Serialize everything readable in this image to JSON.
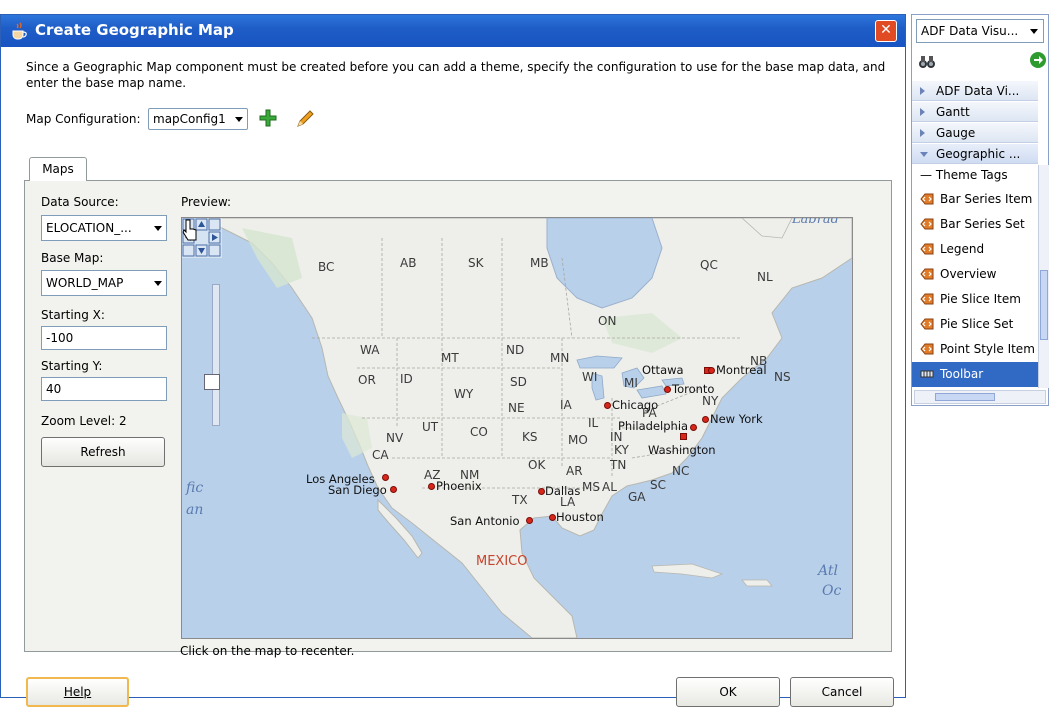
{
  "dialog": {
    "title": "Create Geographic Map",
    "close_label": "✕",
    "description": "Since a Geographic Map component must be created before you can add a theme, specify the configuration to use for the base map data, and enter the base map name.",
    "map_config_label": "Map Configuration:",
    "map_config_value": "mapConfig1",
    "tab_label": "Maps",
    "data_source_label": "Data Source:",
    "data_source_value": "ELOCATION_...",
    "base_map_label": "Base Map:",
    "base_map_value": "WORLD_MAP",
    "start_x_label": "Starting X:",
    "start_x_value": "-100",
    "start_y_label": "Starting Y:",
    "start_y_value": "40",
    "zoom_label": "Zoom Level: 2",
    "refresh_label": "Refresh",
    "preview_label": "Preview:",
    "hint": "Click on the map to recenter.",
    "help_label": "Help",
    "ok_label": "OK",
    "cancel_label": "Cancel"
  },
  "map": {
    "regions": [
      "AB",
      "SK",
      "MB",
      "BC",
      "QC",
      "NL",
      "ON",
      "WA",
      "MT",
      "ND",
      "MN",
      "NB",
      "NS",
      "OR",
      "ID",
      "SD",
      "WI",
      "MI",
      "NY",
      "WY",
      "NE",
      "IA",
      "PA",
      "NV",
      "UT",
      "CO",
      "KS",
      "MO",
      "IL",
      "IN",
      "KY",
      "CA",
      "OK",
      "AR",
      "TN",
      "AZ",
      "NM",
      "SC",
      "NC",
      "TX",
      "MS",
      "AL",
      "GA",
      "LA"
    ],
    "cities": [
      "Ottawa",
      "Montreal",
      "Toronto",
      "Chicago",
      "New York",
      "Philadelphia",
      "Washington",
      "Los Angeles",
      "San Diego",
      "Phoenix",
      "Dallas",
      "Houston",
      "San Antonio"
    ],
    "country": "MEXICO",
    "ocean_left": "fic",
    "ocean_left2": "an",
    "ocean_right": "Atl",
    "ocean_right2": "Oc",
    "top_right": "Labrad",
    "colors": {
      "ocean": "#b9d0ea",
      "land": "#eef0ee",
      "marker": "#d8261b"
    }
  },
  "palette": {
    "combo_value": "ADF Data Visu...",
    "sections": [
      "ADF Data Vi...",
      "Gantt",
      "Gauge",
      "Geographic ..."
    ],
    "subheader": "Theme Tags",
    "items": [
      "Bar Series Item",
      "Bar Series Set",
      "Legend",
      "Overview",
      "Pie Slice Item",
      "Pie Slice Set",
      "Point Style Item",
      "Toolbar"
    ],
    "selected_index": 7
  }
}
